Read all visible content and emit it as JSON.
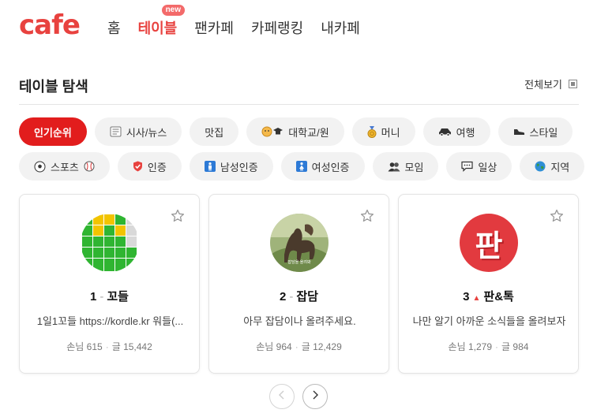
{
  "header": {
    "logo": "cafe",
    "nav": [
      {
        "label": "홈"
      },
      {
        "label": "테이블",
        "badge": "new",
        "active": true
      },
      {
        "label": "팬카페"
      },
      {
        "label": "카페랭킹"
      },
      {
        "label": "내카페"
      }
    ]
  },
  "section": {
    "title": "테이블 탐색",
    "view_all": "전체보기"
  },
  "chips_row1": [
    {
      "label": "인기순위",
      "active": true
    },
    {
      "label": "시사/뉴스",
      "icon": "newspaper-icon"
    },
    {
      "label": "맛집"
    },
    {
      "label": "대학교/원",
      "icon": "student-icon"
    },
    {
      "label": "머니",
      "icon": "medal-icon"
    },
    {
      "label": "여행",
      "icon": "car-icon"
    },
    {
      "label": "스타일",
      "icon": "shoe-icon"
    }
  ],
  "chips_row2": [
    {
      "label": "스포츠",
      "icon": "soccer-ball-icon"
    },
    {
      "label": "인증",
      "icon": "shield-check-icon"
    },
    {
      "label": "남성인증",
      "icon": "man-icon"
    },
    {
      "label": "여성인증",
      "icon": "woman-icon"
    },
    {
      "label": "모임",
      "icon": "people-icon"
    },
    {
      "label": "일상",
      "icon": "speech-bubble-icon"
    },
    {
      "label": "지역",
      "icon": "globe-icon"
    }
  ],
  "cards": [
    {
      "rank": "1",
      "name": "꼬들",
      "description": "1일1꼬들 https://kordle.kr 워들(...",
      "guests_label": "손님",
      "guests": "615",
      "posts_label": "글",
      "posts": "15,442"
    },
    {
      "rank": "2",
      "name": "잡담",
      "description": "아무 잡담이나 올려주세요.",
      "guests_label": "손님",
      "guests": "964",
      "posts_label": "글",
      "posts": "12,429",
      "thumb_caption": "잡담을 올려봐"
    },
    {
      "rank": "3",
      "name": "판&톡",
      "description": "나만 알기 아까운 소식들을 올려보자",
      "guests_label": "손님",
      "guests": "1,279",
      "posts_label": "글",
      "posts": "984",
      "rank_change": "up",
      "thumb_text": "판"
    }
  ],
  "colors": {
    "brand": "#e8423f",
    "active_chip": "#e21d1d"
  }
}
